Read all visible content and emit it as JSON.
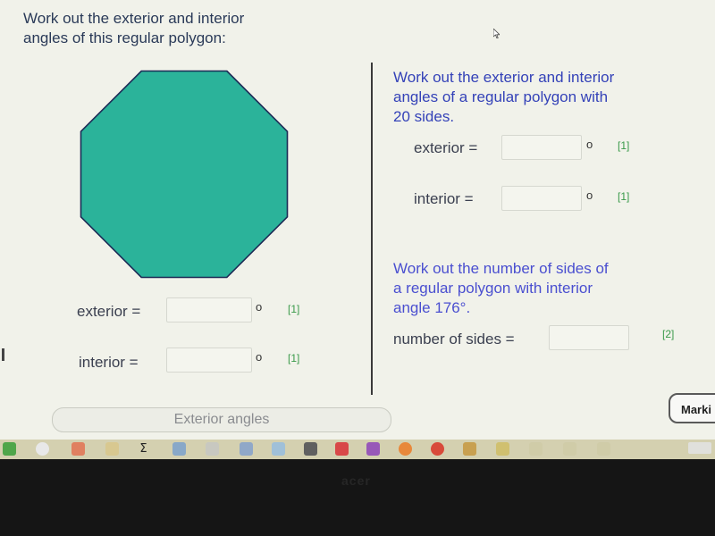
{
  "left_question": {
    "title": "Work out the exterior and interior\nangles of this regular polygon:",
    "polygon": {
      "sides": 8,
      "fill": "#2bb39a",
      "stroke": "#1b2a55"
    },
    "exterior_label": "exterior =",
    "interior_label": "interior =",
    "degree_symbol": "o",
    "exterior_marks": "[1]",
    "interior_marks": "[1]"
  },
  "right_question_1": {
    "title": "Work out the exterior and interior\nangles of a regular polygon with\n20 sides.",
    "exterior_label": "exterior =",
    "interior_label": "interior =",
    "degree_symbol": "o",
    "exterior_marks": "[1]",
    "interior_marks": "[1]"
  },
  "right_question_2": {
    "title": "Work out the number of sides of\na regular polygon with interior\nangle 176°.",
    "sides_label": "number of sides =",
    "marks": "[2]"
  },
  "footer": {
    "topic": "Exterior angles",
    "marking_button": "Marki"
  },
  "taskbar": {
    "icons": [
      "chrome-icon",
      "calendar-icon",
      "folder-icon",
      "sigma-icon",
      "globe-icon",
      "notepad-icon",
      "picture-icon",
      "presentation-icon",
      "onenote-icon",
      "firefox-icon",
      "chrome-icon",
      "image-icon",
      "folder-icon",
      "settings-icon",
      "network-icon",
      "volume-icon",
      "app-icon",
      "app-icon",
      "app-icon"
    ],
    "sigma": "Σ"
  },
  "colors": {
    "question_dark": "#2a3a58",
    "question_blue": "#3442b8",
    "marks_green": "#3a9a4a",
    "screen_bg": "#f1f2ea"
  }
}
